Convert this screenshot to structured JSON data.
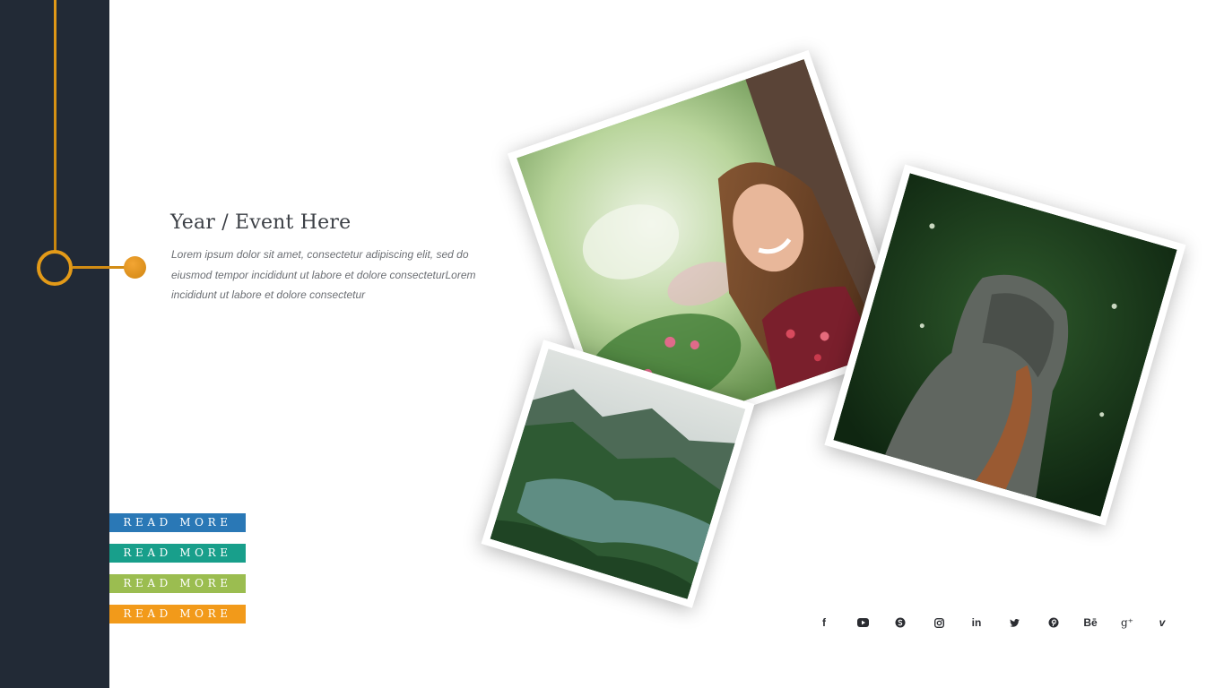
{
  "event": {
    "title": "Year / Event Here",
    "body": "Lorem  ipsum dolor sit amet, consectetur  adipiscing elit, sed do eiusmod tempor  incididunt ut labore et dolore consecteturLorem  incididunt ut labore et dolore consectetur"
  },
  "buttons": [
    {
      "label": "READ MORE",
      "color": "#2a78b6"
    },
    {
      "label": "READ MORE",
      "color": "#189f8b"
    },
    {
      "label": "READ MORE",
      "color": "#9bbd50"
    },
    {
      "label": "READ MORE",
      "color": "#f29a1a"
    }
  ],
  "photos": [
    {
      "subject": "woman-smiling-in-garden"
    },
    {
      "subject": "person-in-grey-hood-among-greenery"
    },
    {
      "subject": "aerial-mountain-lake"
    }
  ],
  "socials": [
    {
      "name": "facebook-icon",
      "glyph": "f"
    },
    {
      "name": "youtube-icon",
      "glyph": ""
    },
    {
      "name": "skype-icon",
      "glyph": ""
    },
    {
      "name": "instagram-icon",
      "glyph": ""
    },
    {
      "name": "linkedin-icon",
      "glyph": "in"
    },
    {
      "name": "twitter-icon",
      "glyph": ""
    },
    {
      "name": "pinterest-icon",
      "glyph": ""
    },
    {
      "name": "behance-icon",
      "glyph": "Bē"
    },
    {
      "name": "google-plus-icon",
      "glyph": "g⁺"
    },
    {
      "name": "vimeo-icon",
      "glyph": "v"
    }
  ],
  "colors": {
    "sidebar": "#222a36",
    "timeline_accent": "#e39a18"
  }
}
